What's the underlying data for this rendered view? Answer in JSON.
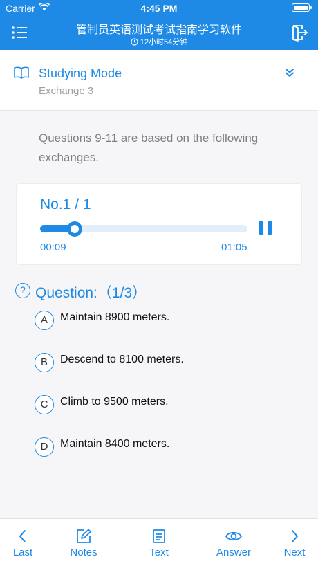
{
  "status_bar": {
    "carrier": "Carrier",
    "time": "4:45 PM"
  },
  "header": {
    "title": "管制员英语测试考试指南学习软件",
    "subtitle": "12小时54分钟"
  },
  "mode": {
    "title": "Studying Mode",
    "subtitle": "Exchange 3"
  },
  "intro": "Questions 9-11 are based on the following exchanges.",
  "player": {
    "count": "No.1 / 1",
    "current_time": "00:09",
    "total_time": "01:05",
    "progress": 0.165
  },
  "question": {
    "title": "Question:（1/3）",
    "options": [
      {
        "letter": "A",
        "text": "Maintain 8900 meters."
      },
      {
        "letter": "B",
        "text": "Descend to 8100 meters."
      },
      {
        "letter": "C",
        "text": "Climb to 9500 meters."
      },
      {
        "letter": "D",
        "text": "Maintain 8400 meters."
      }
    ]
  },
  "tabs": [
    {
      "label": "Last",
      "icon": "chevron-left-icon"
    },
    {
      "label": "Notes",
      "icon": "edit-icon"
    },
    {
      "label": "Text",
      "icon": "document-icon"
    },
    {
      "label": "Answer",
      "icon": "eye-icon"
    },
    {
      "label": "Next",
      "icon": "chevron-right-icon"
    }
  ],
  "colors": {
    "primary": "#1e8ae6",
    "muted": "#a0a0a0",
    "background": "#f6f6f8"
  }
}
